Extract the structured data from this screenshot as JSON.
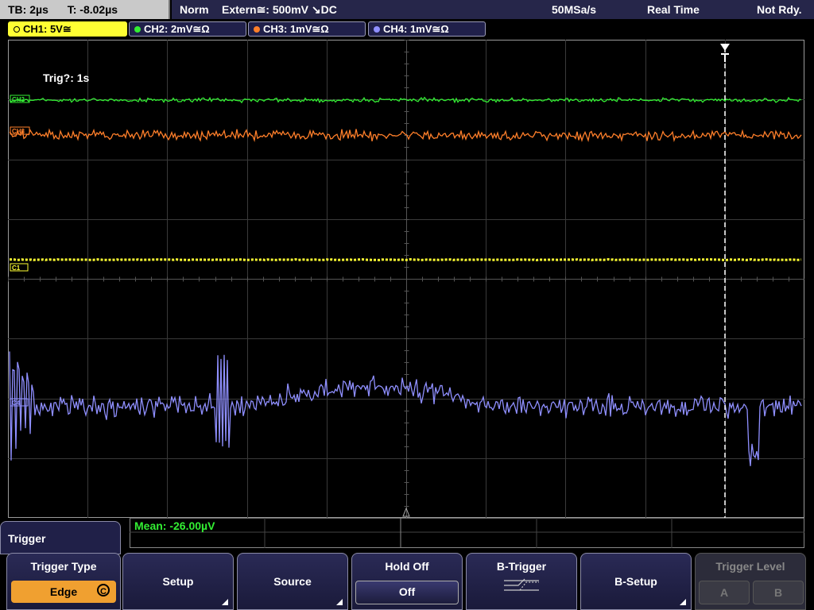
{
  "topbar": {
    "timebase": "TB: 2µs",
    "time_offset": "T: -8.02µs",
    "acq_mode": "Norm",
    "trigger_info": "Extern≅: 500mV ↘DC",
    "sample_rate": "50MSa/s",
    "mode": "Real Time",
    "status": "Not Rdy."
  },
  "channels": [
    {
      "label": "CH1: 5V≅",
      "color": "#ffff33"
    },
    {
      "label": "CH2: 2mV≅Ω",
      "color": "#33ee33"
    },
    {
      "label": "CH3: 1mV≅Ω",
      "color": "#ff7f2a"
    },
    {
      "label": "CH4: 1mV≅Ω",
      "color": "#8f8fff"
    }
  ],
  "screen": {
    "trigger_readout": "Trig?: 1s",
    "markers": [
      "CH2",
      "CH3",
      "C1",
      "C4"
    ],
    "icons": [
      "trigger-position-icon",
      "trigger-level-marker-icon"
    ]
  },
  "measurement": {
    "label": "Mean: -26.00µV",
    "color": "#33ee33"
  },
  "menu": {
    "title": "Trigger",
    "softkeys": {
      "trigger_type_title": "Trigger Type",
      "trigger_type_value": "Edge",
      "setup": "Setup",
      "source": "Source",
      "hold_off_title": "Hold Off",
      "hold_off_value": "Off",
      "b_trigger": "B-Trigger",
      "b_setup": "B-Setup",
      "trigger_level_title": "Trigger Level",
      "level_a": "A",
      "level_b": "B"
    }
  }
}
